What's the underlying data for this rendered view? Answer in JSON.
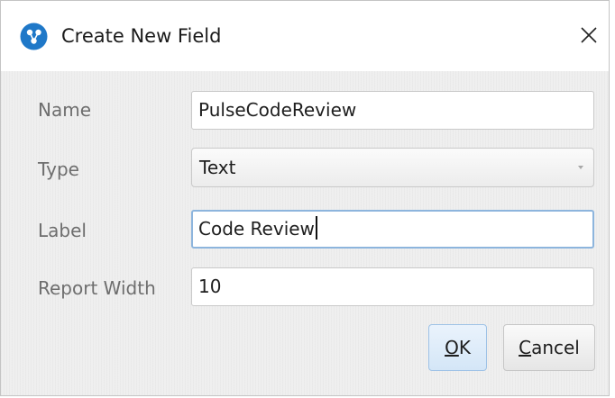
{
  "dialog": {
    "title": "Create New Field",
    "icon": "app-logo-icon",
    "close_icon": "close-icon",
    "close_glyph": "✕"
  },
  "form": {
    "name": {
      "label": "Name",
      "value": "PulseCodeReview"
    },
    "type": {
      "label": "Type",
      "value": "Text",
      "icon": "chevron-down-icon"
    },
    "label": {
      "label": "Label",
      "value": "Code Review"
    },
    "report_width": {
      "label": "Report Width",
      "value": "10"
    }
  },
  "buttons": {
    "ok": {
      "mnemonic": "O",
      "rest": "K"
    },
    "cancel": {
      "mnemonic": "C",
      "rest": "ancel"
    }
  },
  "colors": {
    "accent": "#1f78c8",
    "focus_border": "#8db5dd",
    "body_background": "#efefef",
    "label_text": "#6e6e6e"
  }
}
